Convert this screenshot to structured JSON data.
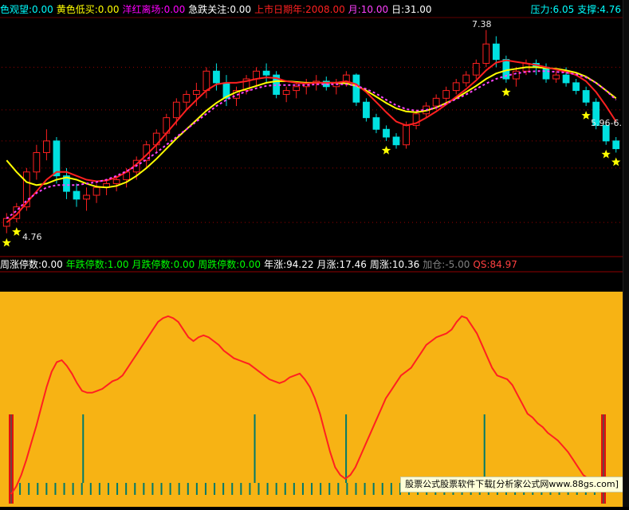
{
  "upper_legend": [
    {
      "text": "色观望:0.00",
      "color": "#00ffff"
    },
    {
      "text": "黄色低买:0.00",
      "color": "#ffff00"
    },
    {
      "text": "洋红离场:0.00",
      "color": "#ff00ff"
    },
    {
      "text": "急跌关注:0.00",
      "color": "#ffffff"
    },
    {
      "text": "上市日期年:2008.00",
      "color": "#ff2020"
    },
    {
      "text": "月:10.00",
      "color": "#ff40ff"
    },
    {
      "text": "日:31.00",
      "color": "#ffffff"
    }
  ],
  "pressure": [
    {
      "text": "压力:6.05",
      "color": "#00ffff"
    },
    {
      "text": "支撑:4.76",
      "color": "#00ffff"
    }
  ],
  "lower_legend": [
    {
      "text": "周涨停数:0.00",
      "color": "#ffffff"
    },
    {
      "text": "年跌停数:1.00",
      "color": "#00ff00"
    },
    {
      "text": "月跌停数:0.00",
      "color": "#00ff00"
    },
    {
      "text": "周跌停数:0.00",
      "color": "#00ff00"
    },
    {
      "text": "年涨:94.22",
      "color": "#ffffff"
    },
    {
      "text": "月涨:17.46",
      "color": "#ffffff"
    },
    {
      "text": "周涨:10.36",
      "color": "#ffffff"
    },
    {
      "text": "加仓:-5.00",
      "color": "#808080"
    },
    {
      "text": "QS:84.97",
      "color": "#ff4040"
    }
  ],
  "price_labels": {
    "high": "7.38",
    "low": "4.76",
    "range": "5.96-6."
  },
  "watermark": "股票公式股票软件下载[分析家公式网www.88gs.com]",
  "colors": {
    "up": "#ff2020",
    "down": "#00e0e0",
    "gold": "#d8b000",
    "lower_bg": "#f7b314",
    "osc": "#ff2020",
    "bar": "#007a6a"
  },
  "chart_data": [
    {
      "type": "candlestick",
      "title": "",
      "ylim": [
        4.5,
        7.5
      ],
      "fields": [
        "open",
        "high",
        "low",
        "close"
      ],
      "candles": [
        [
          4.85,
          5.02,
          4.76,
          4.95
        ],
        [
          4.95,
          5.15,
          4.9,
          5.1
        ],
        [
          5.1,
          5.6,
          5.05,
          5.55
        ],
        [
          5.55,
          5.9,
          5.45,
          5.8
        ],
        [
          5.8,
          6.1,
          5.7,
          5.95
        ],
        [
          5.95,
          6.0,
          5.4,
          5.5
        ],
        [
          5.5,
          5.6,
          5.2,
          5.3
        ],
        [
          5.3,
          5.4,
          5.1,
          5.2
        ],
        [
          5.2,
          5.35,
          5.05,
          5.25
        ],
        [
          5.25,
          5.4,
          5.15,
          5.35
        ],
        [
          5.35,
          5.45,
          5.25,
          5.4
        ],
        [
          5.4,
          5.5,
          5.3,
          5.45
        ],
        [
          5.45,
          5.6,
          5.35,
          5.55
        ],
        [
          5.55,
          5.75,
          5.45,
          5.7
        ],
        [
          5.7,
          5.95,
          5.6,
          5.9
        ],
        [
          5.9,
          6.1,
          5.8,
          6.05
        ],
        [
          6.05,
          6.3,
          5.95,
          6.25
        ],
        [
          6.25,
          6.5,
          6.15,
          6.45
        ],
        [
          6.45,
          6.6,
          6.35,
          6.55
        ],
        [
          6.55,
          6.7,
          6.4,
          6.6
        ],
        [
          6.6,
          6.9,
          6.5,
          6.85
        ],
        [
          6.85,
          6.95,
          6.6,
          6.7
        ],
        [
          6.7,
          6.8,
          6.4,
          6.5
        ],
        [
          6.5,
          6.65,
          6.4,
          6.6
        ],
        [
          6.6,
          6.8,
          6.55,
          6.75
        ],
        [
          6.75,
          6.9,
          6.65,
          6.85
        ],
        [
          6.85,
          6.95,
          6.7,
          6.8
        ],
        [
          6.8,
          6.85,
          6.5,
          6.55
        ],
        [
          6.55,
          6.65,
          6.45,
          6.6
        ],
        [
          6.6,
          6.7,
          6.5,
          6.65
        ],
        [
          6.65,
          6.75,
          6.55,
          6.7
        ],
        [
          6.7,
          6.8,
          6.6,
          6.72
        ],
        [
          6.72,
          6.78,
          6.6,
          6.65
        ],
        [
          6.65,
          6.75,
          6.55,
          6.7
        ],
        [
          6.7,
          6.85,
          6.65,
          6.8
        ],
        [
          6.8,
          6.82,
          6.4,
          6.45
        ],
        [
          6.45,
          6.5,
          6.2,
          6.25
        ],
        [
          6.25,
          6.3,
          6.05,
          6.1
        ],
        [
          6.1,
          6.15,
          5.95,
          6.0
        ],
        [
          6.0,
          6.05,
          5.85,
          5.9
        ],
        [
          5.9,
          6.2,
          5.85,
          6.15
        ],
        [
          6.15,
          6.35,
          6.1,
          6.3
        ],
        [
          6.3,
          6.45,
          6.25,
          6.4
        ],
        [
          6.4,
          6.55,
          6.35,
          6.5
        ],
        [
          6.5,
          6.65,
          6.45,
          6.6
        ],
        [
          6.6,
          6.75,
          6.55,
          6.7
        ],
        [
          6.7,
          6.85,
          6.65,
          6.8
        ],
        [
          6.8,
          7.0,
          6.75,
          6.95
        ],
        [
          6.95,
          7.38,
          6.9,
          7.2
        ],
        [
          7.2,
          7.3,
          6.9,
          7.0
        ],
        [
          7.0,
          7.05,
          6.7,
          6.75
        ],
        [
          6.75,
          6.9,
          6.65,
          6.85
        ],
        [
          6.85,
          7.0,
          6.8,
          6.95
        ],
        [
          6.95,
          7.0,
          6.8,
          6.9
        ],
        [
          6.9,
          6.95,
          6.7,
          6.75
        ],
        [
          6.75,
          6.85,
          6.7,
          6.8
        ],
        [
          6.8,
          6.9,
          6.65,
          6.7
        ],
        [
          6.7,
          6.75,
          6.55,
          6.6
        ],
        [
          6.6,
          6.65,
          6.4,
          6.45
        ],
        [
          6.45,
          6.5,
          6.1,
          6.15
        ],
        [
          6.15,
          6.2,
          5.9,
          5.95
        ],
        [
          5.95,
          6.0,
          5.8,
          5.85
        ]
      ],
      "lines": [
        {
          "color": "#ffff00",
          "values": [
            5.7,
            5.55,
            5.42,
            5.38,
            5.4,
            5.45,
            5.48,
            5.45,
            5.4,
            5.36,
            5.35,
            5.37,
            5.42,
            5.5,
            5.6,
            5.72,
            5.85,
            5.98,
            6.1,
            6.22,
            6.34,
            6.44,
            6.52,
            6.58,
            6.62,
            6.66,
            6.7,
            6.72,
            6.72,
            6.71,
            6.7,
            6.7,
            6.7,
            6.7,
            6.69,
            6.66,
            6.6,
            6.52,
            6.44,
            6.37,
            6.33,
            6.32,
            6.34,
            6.38,
            6.44,
            6.5,
            6.58,
            6.66,
            6.75,
            6.82,
            6.86,
            6.88,
            6.9,
            6.9,
            6.89,
            6.88,
            6.86,
            6.83,
            6.78,
            6.7,
            6.6,
            6.5
          ]
        },
        {
          "color": "#ff2020",
          "values": [
            4.9,
            5.0,
            5.15,
            5.3,
            5.45,
            5.55,
            5.55,
            5.5,
            5.45,
            5.43,
            5.44,
            5.48,
            5.55,
            5.65,
            5.77,
            5.9,
            6.05,
            6.2,
            6.35,
            6.48,
            6.6,
            6.68,
            6.7,
            6.7,
            6.72,
            6.75,
            6.77,
            6.76,
            6.72,
            6.7,
            6.69,
            6.7,
            6.7,
            6.7,
            6.72,
            6.68,
            6.58,
            6.45,
            6.32,
            6.2,
            6.15,
            6.18,
            6.25,
            6.33,
            6.42,
            6.52,
            6.62,
            6.73,
            6.86,
            6.96,
            6.99,
            6.97,
            6.95,
            6.93,
            6.9,
            6.87,
            6.84,
            6.8,
            6.72,
            6.58,
            6.4,
            6.2
          ]
        },
        {
          "color": "#ff44ff",
          "values": [
            4.95,
            5.05,
            5.18,
            5.28,
            5.35,
            5.38,
            5.38,
            5.38,
            5.4,
            5.42,
            5.45,
            5.5,
            5.56,
            5.63,
            5.71,
            5.8,
            5.9,
            6.0,
            6.1,
            6.2,
            6.3,
            6.4,
            6.48,
            6.54,
            6.59,
            6.63,
            6.66,
            6.67,
            6.67,
            6.67,
            6.67,
            6.68,
            6.68,
            6.68,
            6.68,
            6.66,
            6.62,
            6.56,
            6.48,
            6.41,
            6.36,
            6.34,
            6.35,
            6.38,
            6.43,
            6.49,
            6.55,
            6.62,
            6.69,
            6.75,
            6.79,
            6.82,
            6.84,
            6.85,
            6.85,
            6.84,
            6.83,
            6.81,
            6.77,
            6.7,
            6.6,
            6.48
          ]
        }
      ],
      "stars": [
        0,
        1,
        38,
        50,
        58,
        60,
        61
      ],
      "dotted_levels": [
        4.9,
        5.6,
        5.95,
        6.35,
        6.9
      ]
    },
    {
      "type": "line",
      "title": "",
      "ylim": [
        0,
        100
      ],
      "series": [
        {
          "values": [
            0,
            4,
            10,
            18,
            27,
            36,
            46,
            56,
            64,
            69,
            70,
            67,
            63,
            58,
            54,
            53,
            53,
            54,
            55,
            57,
            59,
            60,
            62,
            66,
            70,
            74,
            78,
            82,
            86,
            90,
            92,
            93,
            92,
            90,
            86,
            82,
            80,
            82,
            83,
            82,
            80,
            78,
            75,
            73,
            71,
            70,
            69,
            68,
            66,
            64,
            62,
            60,
            59,
            58,
            59,
            61,
            62,
            63,
            60,
            56,
            50,
            42,
            32,
            22,
            14,
            10,
            8,
            10,
            14,
            20,
            26,
            32,
            38,
            44,
            50,
            54,
            58,
            62,
            64,
            66,
            70,
            74,
            78,
            80,
            82,
            83,
            84,
            86,
            90,
            93,
            92,
            88,
            84,
            78,
            72,
            66,
            62,
            61,
            60,
            57,
            52,
            47,
            42,
            40,
            37,
            35,
            32,
            30,
            28,
            25,
            22,
            18,
            14,
            10,
            8,
            6,
            4,
            3
          ]
        }
      ],
      "markers": {
        "tall": [
          0,
          26,
          88,
          121,
          171,
          214
        ],
        "short_count": 68
      }
    }
  ]
}
